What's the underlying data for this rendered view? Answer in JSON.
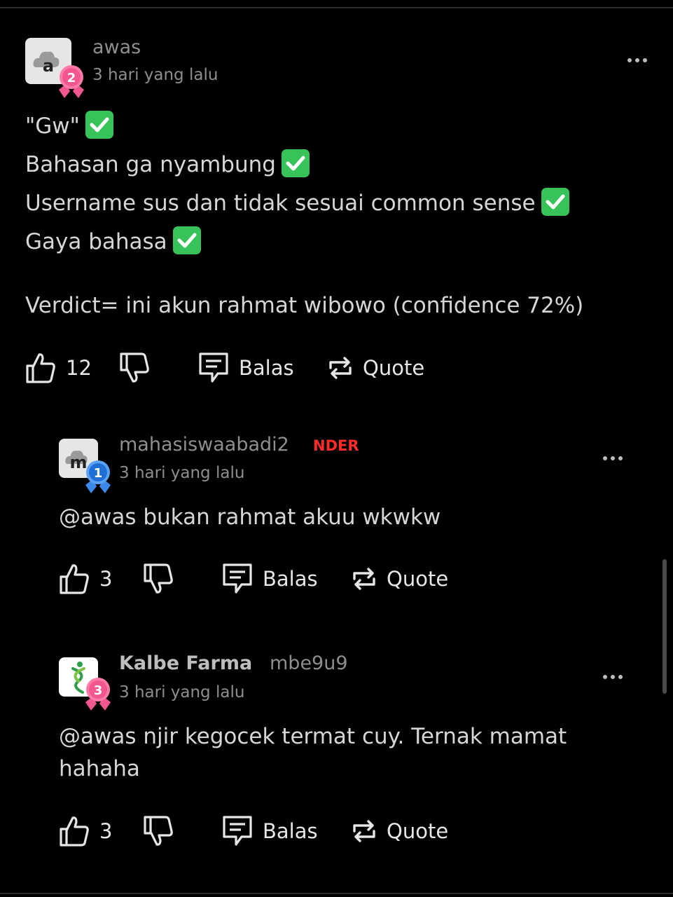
{
  "comments": [
    {
      "username": "awas",
      "avatar_initial": "a",
      "rank": "2",
      "time": "3 hari yang lalu",
      "lines": [
        "\"Gw\"",
        "Bahasan ga nyambung",
        "Username sus dan tidak sesuai common sense",
        "Gaya bahasa",
        "Verdict= ini akun rahmat wibowo (confidence 72%)"
      ],
      "likes": "12",
      "reply_label": "Balas",
      "quote_label": "Quote"
    },
    {
      "username": "mahasiswaabadi2",
      "tag": "NDER",
      "avatar_initial": "m",
      "rank": "1",
      "time": "3 hari yang lalu",
      "lines": [
        "@awas bukan rahmat akuu wkwkw"
      ],
      "likes": "3",
      "reply_label": "Balas",
      "quote_label": "Quote"
    },
    {
      "username": "Kalbe Farma",
      "handle": "mbe9u9",
      "rank": "3",
      "time": "3 hari yang lalu",
      "lines": [
        "@awas njir kegocek termat cuy. Ternak mamat",
        "hahaha"
      ],
      "likes": "3",
      "reply_label": "Balas",
      "quote_label": "Quote"
    }
  ],
  "colors": {
    "background": "#000000",
    "check_green": "#38c25a",
    "tag_red": "#ff2a2a",
    "badge_pink": "#f2568f",
    "badge_blue": "#1f6fd6"
  },
  "icons": [
    "like-icon",
    "dislike-icon",
    "reply-icon",
    "quote-icon",
    "more-icon",
    "check-icon",
    "rank-badge-icon"
  ]
}
